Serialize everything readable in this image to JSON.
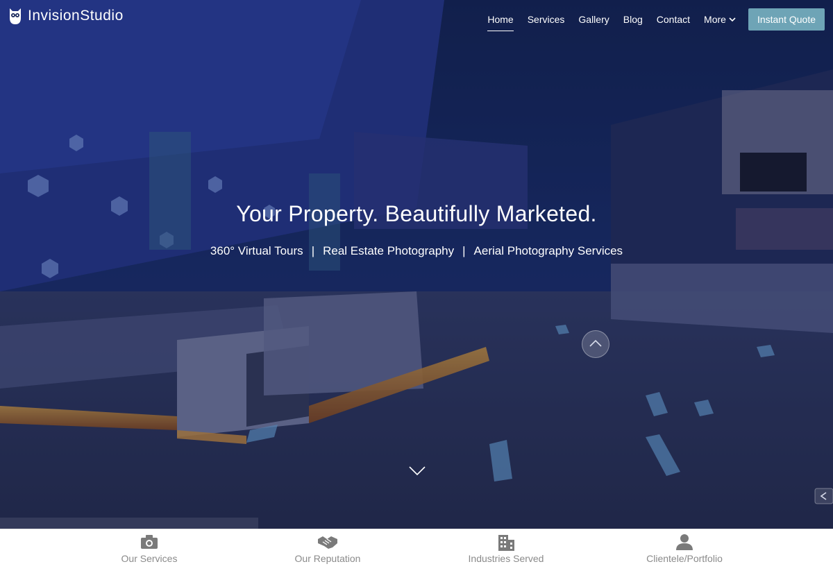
{
  "brand": {
    "name": "InvisionStudio",
    "logo_icon": "owl-icon"
  },
  "nav": {
    "items": [
      {
        "label": "Home",
        "active": true
      },
      {
        "label": "Services"
      },
      {
        "label": "Gallery"
      },
      {
        "label": "Blog"
      },
      {
        "label": "Contact"
      },
      {
        "label": "More",
        "icon": "chevron-down-icon"
      }
    ],
    "cta": "Instant Quote"
  },
  "hero": {
    "headline": "Your Property. Beautifully Marketed.",
    "tagline": {
      "items": [
        "360° Virtual Tours",
        "Real Estate Photography",
        "Aerial Photography Services"
      ],
      "separator": "|"
    }
  },
  "bottom_bar": {
    "items": [
      {
        "label": "Our Services",
        "icon": "camera-icon"
      },
      {
        "label": "Our Reputation",
        "icon": "handshake-icon"
      },
      {
        "label": "Industries Served",
        "icon": "building-icon"
      },
      {
        "label": "Clientele/Portfolio",
        "icon": "person-icon"
      }
    ]
  },
  "colors": {
    "cta_bg": "#6ea4b6",
    "bottom_label": "#8a8a8a",
    "icon_gray": "#7a7a7a"
  }
}
